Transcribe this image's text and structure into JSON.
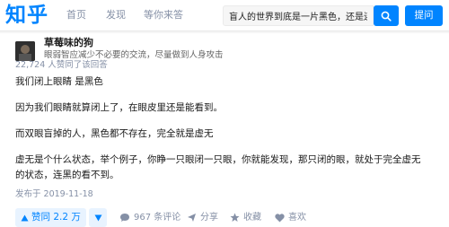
{
  "header": {
    "logo": "知乎",
    "nav": [
      "首页",
      "发现",
      "等你来答"
    ],
    "search": {
      "value": "盲人的世界到底是一片黑色，还是连黑色"
    },
    "ask_label": "提问"
  },
  "answer": {
    "author": {
      "name": "草莓味的狗",
      "bio": "眼弱智应减少不必要的交流，尽量做到人身攻击"
    },
    "vote_summary": "22,724 人赞同了该回答",
    "paragraphs": [
      "我们闭上眼睛 是黑色",
      "因为我们眼睛就算闭上了，在眼皮里还是能看到。",
      "而双眼盲掉的人，黑色都不存在，完全就是虚无",
      "虚无是个什么状态，举个例子，你睁一只眼闭一只眼，你就能发现，那只闭的眼，就处于完全虚无",
      "的状态，连黑的看不到。"
    ],
    "published": "发布于 2019-11-18"
  },
  "actions": {
    "upvote_label": "赞同 2.2 万",
    "comments_label": "967 条评论",
    "share_label": "分享",
    "favorite_label": "收藏",
    "like_label": "喜欢"
  },
  "colors": {
    "brand": "#0084ff",
    "muted": "#8590a6",
    "upvote_bg": "#e8f3ff"
  }
}
